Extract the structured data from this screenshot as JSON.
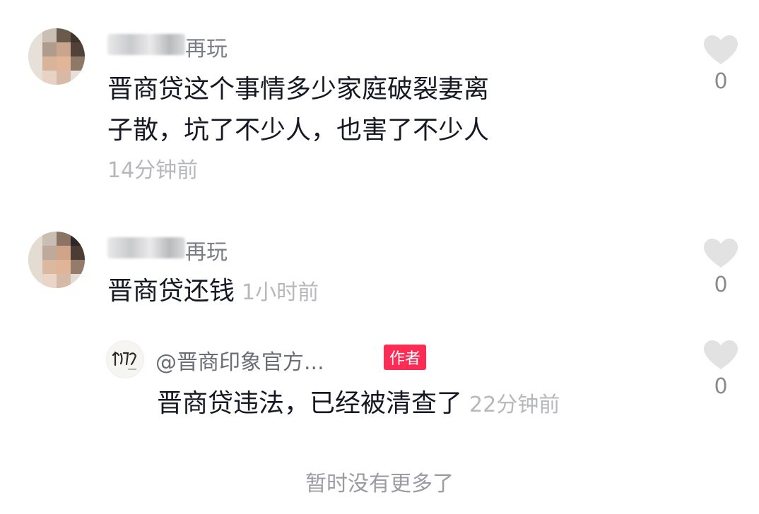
{
  "comments": [
    {
      "username": "再玩",
      "text_line1": "晋商贷这个事情多少家庭破裂妻离",
      "text_line2": "子散，坑了不少人，也害了不少人",
      "time": "14分钟前",
      "likes": "0"
    },
    {
      "username": "再玩",
      "text": "晋商贷还钱",
      "time": "1小时前",
      "likes": "0",
      "reply": {
        "username": "@晋商印象官方...",
        "badge": "作者",
        "text": "晋商贷违法，已经被清查了",
        "time": "22分钟前",
        "likes": "0"
      }
    }
  ],
  "footer": "暂时没有更多了",
  "colors": {
    "accent": "#fe2c55",
    "text": "#161823",
    "secondary": "#b6b8bd",
    "heart": "#e2e2e3"
  }
}
